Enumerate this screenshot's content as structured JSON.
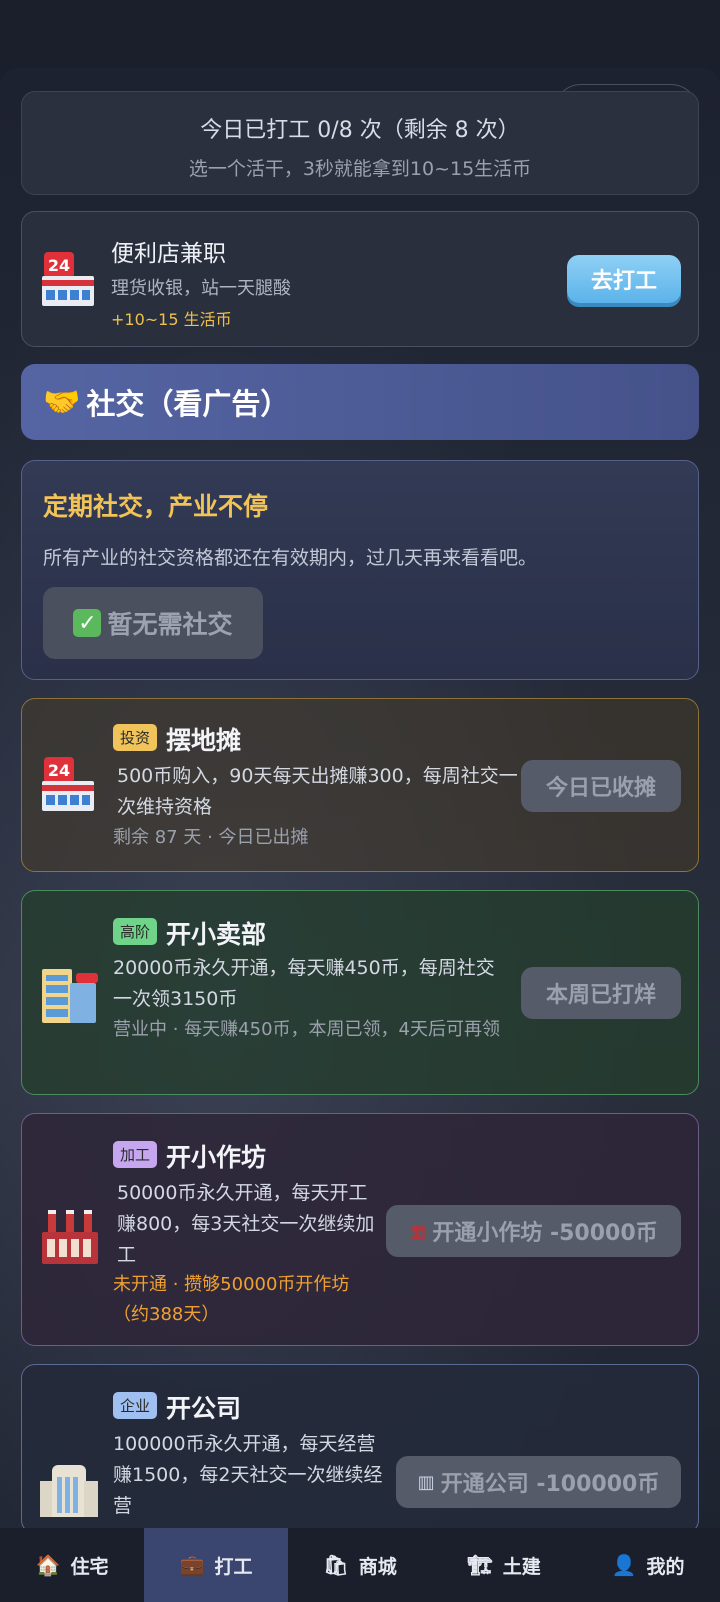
{
  "summary": {
    "line1": "今日已打工 0/8 次（剩余 8 次）",
    "line2": "选一个活干，3秒就能拿到10~15生活币"
  },
  "job": {
    "title": "便利店兼职",
    "desc": "理货收银，站一天腿酸",
    "reward": "+10~15 生活币",
    "button": "去打工"
  },
  "social_section": {
    "title": "社交（看广告）",
    "icon": "handshake-icon"
  },
  "social_notice": {
    "title": "定期社交，产业不停",
    "desc": "所有产业的社交资格都还在有效期内，过几天再来看看吧。",
    "button": "暂无需社交"
  },
  "businesses": [
    {
      "tag": "投资",
      "tag_color": "#f0c45a",
      "name": "摆地摊",
      "desc": "500币购入，90天每天出摊赚300，每周社交一次维持资格",
      "status": "剩余 87 天 · 今日已出摊",
      "status_color": "#9aa0ac",
      "button": "今日已收摊",
      "icon": "convenience-store-icon"
    },
    {
      "tag": "高阶",
      "tag_color": "#6fd38a",
      "name": "开小卖部",
      "desc": "20000币永久开通，每天赚450币，每周社交一次领3150币",
      "status": "营业中 · 每天赚450币，本周已领，4天后可再领",
      "status_color": "#9aa0ac",
      "button": "本周已打烊",
      "icon": "office-building-icon"
    },
    {
      "tag": "加工",
      "tag_color": "#c7a6f0",
      "name": "开小作坊",
      "desc": "50000币永久开通，每天开工赚800，每3天社交一次继续加工",
      "status": "未开通 · 攒够50000币开作坊（约388天）",
      "status_color": "#f0a030",
      "button": "开通小作坊 -50000币",
      "icon": "factory-icon"
    },
    {
      "tag": "企业",
      "tag_color": "#9fc0f0",
      "name": "开公司",
      "desc": "100000币永久开通，每天经营赚1500，每2天社交一次继续经营",
      "button": "开通公司 -100000币",
      "icon": "corporate-building-icon"
    }
  ],
  "tabbar": [
    {
      "label": "住宅",
      "icon": "house-icon"
    },
    {
      "label": "打工",
      "icon": "briefcase-icon",
      "active": true
    },
    {
      "label": "商城",
      "icon": "shopping-bags-icon"
    },
    {
      "label": "土建",
      "icon": "construction-icon"
    },
    {
      "label": "我的",
      "icon": "user-icon"
    }
  ]
}
